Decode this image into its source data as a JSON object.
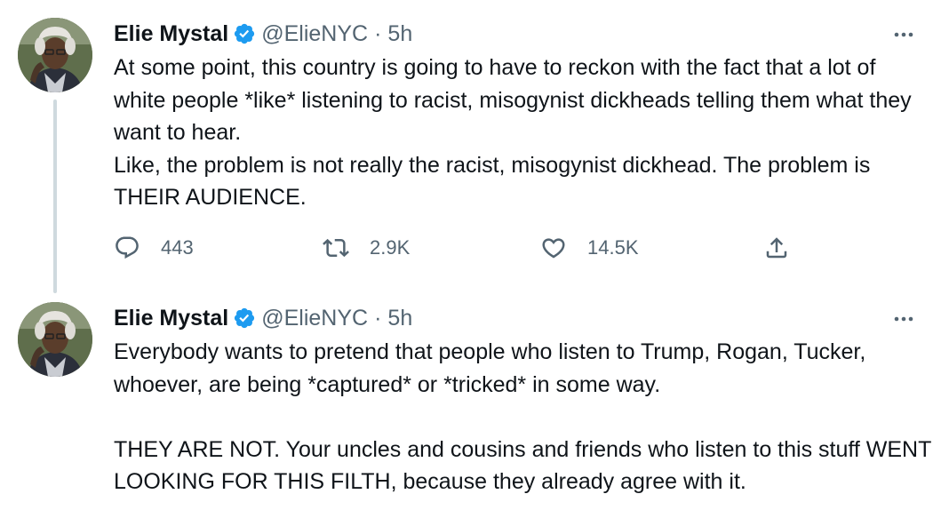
{
  "tweets": [
    {
      "author": {
        "name": "Elie Mystal",
        "handle": "@ElieNYC"
      },
      "separator": "·",
      "time": "5h",
      "paragraphs": [
        "At some point, this country is going to have to reckon with the fact that a lot of white people *like* listening to racist, misogynist dickheads telling them what they want to hear.",
        "Like, the problem is not really the racist, misogynist dickhead. The problem is THEIR AUDIENCE."
      ],
      "actions": {
        "replies": "443",
        "retweets": "2.9K",
        "likes": "14.5K"
      }
    },
    {
      "author": {
        "name": "Elie Mystal",
        "handle": "@ElieNYC"
      },
      "separator": "·",
      "time": "5h",
      "paragraphs": [
        "Everybody wants to pretend that people who listen to Trump, Rogan, Tucker, whoever, are being *captured* or *tricked* in some way.",
        "THEY ARE NOT. Your uncles and cousins and friends who listen to this stuff WENT LOOKING FOR THIS FILTH, because they already agree with it."
      ]
    }
  ],
  "icons": {
    "verified": "verified-badge-icon",
    "more": "more-options-icon",
    "reply": "reply-icon",
    "retweet": "retweet-icon",
    "like": "like-icon",
    "share": "share-icon"
  },
  "colors": {
    "verified": "#1d9bf0",
    "text": "#0f1419",
    "secondary": "#536471",
    "thread_line": "#cfd9de"
  }
}
